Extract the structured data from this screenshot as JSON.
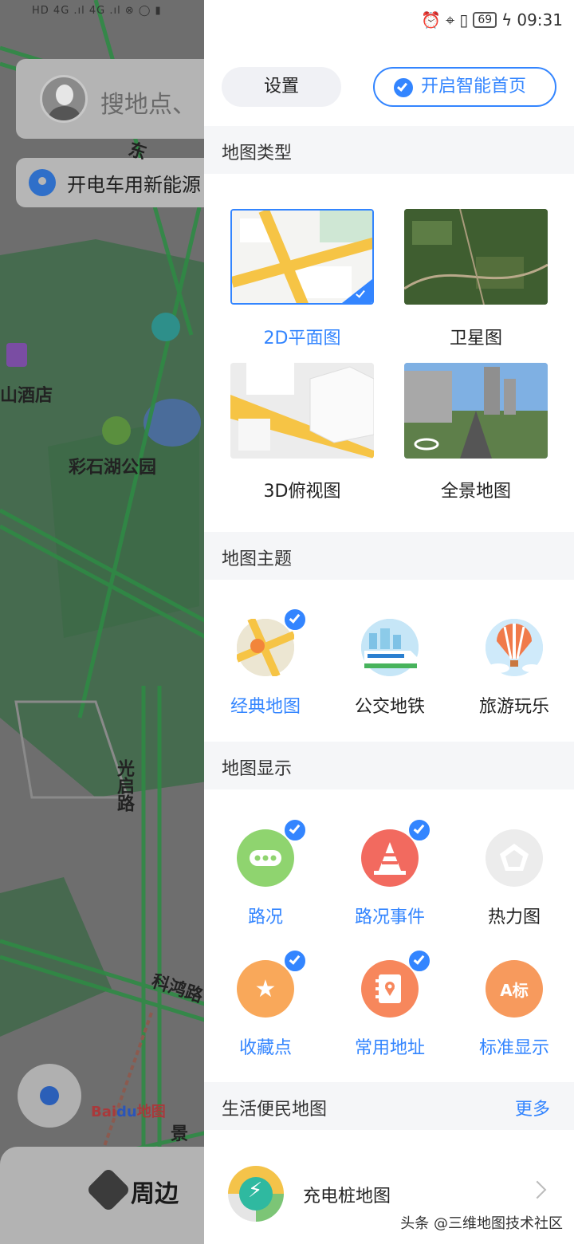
{
  "map": {
    "search_placeholder": "搜地点、",
    "ev_banner": "开电车用新能源",
    "labels": {
      "hotel": "山酒店",
      "park": "彩石湖公园",
      "road_guangqi": "光启路",
      "road_kehong": "科鸿路",
      "top_char": "东",
      "landmark": "景"
    },
    "baidu_logo_a": "Bai",
    "baidu_logo_b": "du",
    "baidu_logo_c": "地图",
    "bottom_tab": "周边"
  },
  "status_bar": {
    "battery": "69",
    "time": "09:31"
  },
  "header": {
    "settings_label": "设置",
    "smart_home_label": "开启智能首页"
  },
  "map_type": {
    "title": "地图类型",
    "items": [
      {
        "label": "2D平面图",
        "selected": true
      },
      {
        "label": "卫星图",
        "selected": false
      },
      {
        "label": "3D俯视图",
        "selected": false
      },
      {
        "label": "全景地图",
        "selected": false
      }
    ]
  },
  "map_theme": {
    "title": "地图主题",
    "items": [
      {
        "label": "经典地图",
        "icon": "classic-map-icon",
        "selected": true
      },
      {
        "label": "公交地铁",
        "icon": "transit-icon",
        "selected": false
      },
      {
        "label": "旅游玩乐",
        "icon": "hot-air-balloon-icon",
        "selected": false
      }
    ]
  },
  "map_display": {
    "title": "地图显示",
    "items": [
      {
        "label": "路况",
        "icon": "traffic-icon",
        "selected": true,
        "color": "#8fd46f"
      },
      {
        "label": "路况事件",
        "icon": "traffic-cone-icon",
        "selected": true,
        "color": "#f26a5f"
      },
      {
        "label": "热力图",
        "icon": "heatmap-icon",
        "selected": false,
        "color": "#e6e6e6"
      },
      {
        "label": "收藏点",
        "icon": "star-icon",
        "selected": true,
        "color": "#f9a85a"
      },
      {
        "label": "常用地址",
        "icon": "address-book-icon",
        "selected": true,
        "color": "#f7875c"
      },
      {
        "label": "标准显示",
        "icon": "standard-display-icon",
        "selected": false,
        "color": "#f79a5d",
        "glyph": "A标"
      }
    ]
  },
  "life_map": {
    "title": "生活便民地图",
    "more_label": "更多",
    "item_label": "充电桩地图",
    "bolt": "⚡"
  },
  "watermark": "头条 @三维地图技术社区",
  "colors": {
    "accent": "#3385ff",
    "section_bg": "#f5f6f8"
  }
}
